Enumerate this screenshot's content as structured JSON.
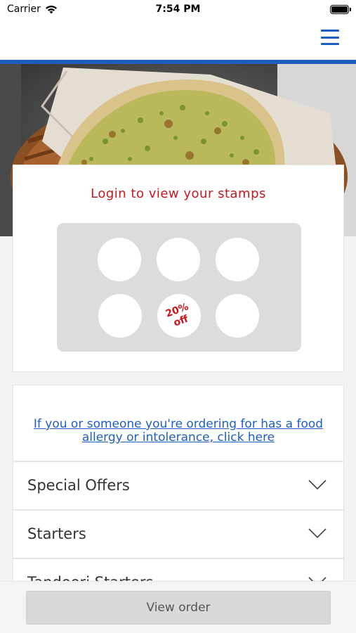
{
  "status_bar": {
    "carrier": "Carrier",
    "time": "7:54 PM"
  },
  "nav": {
    "menu_icon": "hamburger-menu-icon",
    "accent_color": "#1d5fc1"
  },
  "hero": {
    "image": "garlic-naan-in-basket"
  },
  "loyalty": {
    "title": "Login to view your stamps",
    "stamp_count": 6,
    "reward_text": "20% off",
    "title_color": "#c8161d"
  },
  "allergy": {
    "link_text": "If you or someone you're ordering for has a food allergy or intolerance, click here"
  },
  "menu_sections": [
    {
      "label": "Special Offers",
      "icon": "chevron-down-icon"
    },
    {
      "label": "Starters",
      "icon": "chevron-down-icon"
    },
    {
      "label": "Tandoori Starters",
      "icon": "chevron-down-icon"
    }
  ],
  "footer": {
    "view_order_label": "View order"
  }
}
